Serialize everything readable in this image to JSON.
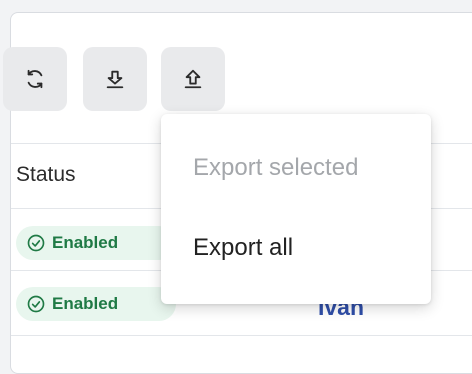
{
  "toolbar": {
    "refresh_icon": "refresh-icon",
    "import_icon": "import-icon",
    "export_icon": "export-icon"
  },
  "table": {
    "columns": [
      "Status"
    ],
    "rows": [
      {
        "status": "Enabled",
        "name": ""
      },
      {
        "status": "Enabled",
        "name": "Ivan"
      }
    ]
  },
  "export_menu": {
    "items": [
      {
        "label": "Export selected",
        "disabled": true
      },
      {
        "label": "Export all",
        "disabled": false
      }
    ]
  },
  "colors": {
    "badge_bg": "#e8f6ee",
    "badge_text": "#1f7a45",
    "link": "#2f4ea8",
    "disabled": "#a4a7ab"
  }
}
